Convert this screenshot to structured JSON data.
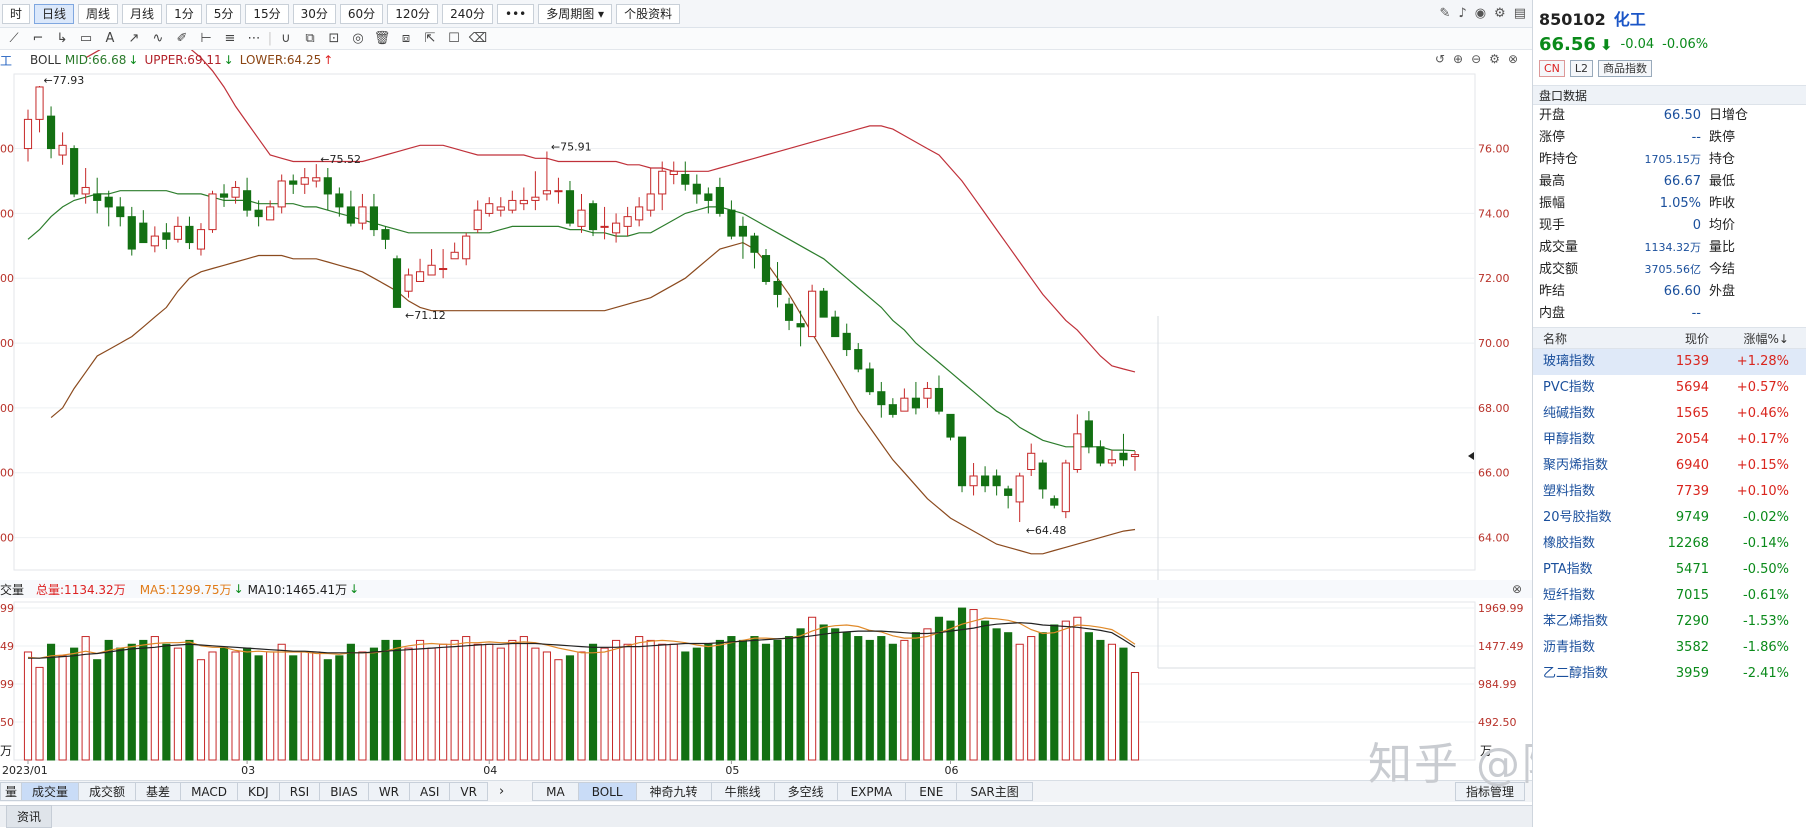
{
  "topbar": {
    "periods": [
      {
        "label": "时",
        "active": false
      },
      {
        "label": "日线",
        "active": true
      },
      {
        "label": "周线",
        "active": false
      },
      {
        "label": "月线",
        "active": false
      },
      {
        "label": "1分",
        "active": false
      },
      {
        "label": "5分",
        "active": false
      },
      {
        "label": "15分",
        "active": false
      },
      {
        "label": "30分",
        "active": false
      },
      {
        "label": "60分",
        "active": false
      },
      {
        "label": "120分",
        "active": false
      },
      {
        "label": "240分",
        "active": false
      },
      {
        "label": "•••",
        "active": false
      },
      {
        "label": "多周期图 ▾",
        "active": false
      },
      {
        "label": "个股资料",
        "active": false
      }
    ]
  },
  "indicator": {
    "name": "BOLL",
    "mid": "MID:66.68",
    "upper": "UPPER:69.11",
    "lower": "LOWER:64.25",
    "left_cut": "工"
  },
  "volume_legend": {
    "left_cut": "交量",
    "total": "总量:1134.32万",
    "ma5": "MA5:1299.75万",
    "ma10": "MA10:1465.41万"
  },
  "annotations": {
    "hi1": "←77.93",
    "hi2": "←75.52",
    "hi3": "←75.91",
    "lo1": "←71.12",
    "lo2": "←64.48"
  },
  "price_axis_right": [
    "76.00",
    "74.00",
    "72.00",
    "70.00",
    "68.00",
    "66.00",
    "64.00"
  ],
  "price_axis_left": [
    "00",
    "00",
    "00",
    "00",
    "00",
    "00",
    "00"
  ],
  "volume_axis_right": [
    "1969.99",
    "1477.49",
    "984.99",
    "492.50"
  ],
  "volume_axis_left": [
    "99",
    "49",
    "99",
    "50"
  ],
  "vol_unit_right": "万",
  "vol_unit_left": "万",
  "date_labels": [
    "2023/01",
    "03",
    "04",
    "05",
    "06"
  ],
  "bottom_tabs_left": [
    "量",
    "成交量",
    "成交额",
    "基差",
    "MACD",
    "KDJ",
    "RSI",
    "BIAS",
    "WR",
    "ASI",
    "VR"
  ],
  "bottom_tabs_right": [
    "MA",
    "BOLL",
    "神奇九转",
    "牛熊线",
    "多空线",
    "EXPMA",
    "ENE",
    "SAR主图"
  ],
  "indicator_manage": "指标管理",
  "status_tab": "资讯",
  "watermark": "知乎 @随波而动",
  "quote": {
    "code": "850102",
    "name": "化工",
    "price": "66.56",
    "change": "-0.04",
    "change_pct": "-0.06%",
    "tags": [
      "CN",
      "L2",
      "商品指数"
    ],
    "section_title": "盘口数据",
    "rows": [
      {
        "l": "开盘",
        "v": "66.50",
        "r": "日增仓",
        "small": false
      },
      {
        "l": "涨停",
        "v": "--",
        "r": "跌停",
        "small": false
      },
      {
        "l": "昨持仓",
        "v": "1705.15万",
        "r": "持仓",
        "small": true
      },
      {
        "l": "最高",
        "v": "66.67",
        "r": "最低",
        "small": false
      },
      {
        "l": "振幅",
        "v": "1.05%",
        "r": "昨收",
        "small": false
      },
      {
        "l": "现手",
        "v": "0",
        "r": "均价",
        "small": false
      },
      {
        "l": "成交量",
        "v": "1134.32万",
        "r": "量比",
        "small": true
      },
      {
        "l": "成交额",
        "v": "3705.56亿",
        "r": "今结",
        "small": true
      },
      {
        "l": "昨结",
        "v": "66.60",
        "r": "外盘",
        "small": false
      },
      {
        "l": "内盘",
        "v": "--",
        "r": "",
        "small": false
      }
    ]
  },
  "index_table": {
    "headers": [
      "名称",
      "现价",
      "涨幅%↓"
    ],
    "rows": [
      {
        "name": "玻璃指数",
        "price": "1539",
        "pct": "+1.28%",
        "up": true
      },
      {
        "name": "PVC指数",
        "price": "5694",
        "pct": "+0.57%",
        "up": true
      },
      {
        "name": "纯碱指数",
        "price": "1565",
        "pct": "+0.46%",
        "up": true
      },
      {
        "name": "甲醇指数",
        "price": "2054",
        "pct": "+0.17%",
        "up": true
      },
      {
        "name": "聚丙烯指数",
        "price": "6940",
        "pct": "+0.15%",
        "up": true
      },
      {
        "name": "塑料指数",
        "price": "7739",
        "pct": "+0.10%",
        "up": true
      },
      {
        "name": "20号胶指数",
        "price": "9749",
        "pct": "-0.02%",
        "up": false
      },
      {
        "name": "橡胶指数",
        "price": "12268",
        "pct": "-0.14%",
        "up": false
      },
      {
        "name": "PTA指数",
        "price": "5471",
        "pct": "-0.50%",
        "up": false
      },
      {
        "name": "短纤指数",
        "price": "7015",
        "pct": "-0.61%",
        "up": false
      },
      {
        "name": "苯乙烯指数",
        "price": "7290",
        "pct": "-1.53%",
        "up": false
      },
      {
        "name": "沥青指数",
        "price": "3582",
        "pct": "-1.86%",
        "up": false
      },
      {
        "name": "乙二醇指数",
        "price": "3959",
        "pct": "-2.41%",
        "up": false
      }
    ]
  },
  "chart_data": {
    "type": "candlestick",
    "y_range": [
      63,
      78.3
    ],
    "volume_range": [
      0,
      1969.99
    ],
    "candles": [
      [
        76.0,
        76.9,
        77.2,
        75.6
      ],
      [
        76.9,
        77.9,
        77.93,
        76.5
      ],
      [
        77.0,
        76.0,
        77.3,
        75.7
      ],
      [
        75.8,
        76.1,
        76.5,
        75.5
      ],
      [
        76.0,
        74.6,
        76.1,
        74.5
      ],
      [
        74.6,
        74.8,
        75.4,
        74.3
      ],
      [
        74.6,
        74.4,
        75.1,
        74.0
      ],
      [
        74.5,
        74.2,
        74.7,
        73.6
      ],
      [
        74.2,
        73.9,
        74.5,
        73.6
      ],
      [
        73.9,
        72.9,
        74.2,
        72.7
      ],
      [
        73.7,
        73.1,
        74.1,
        73.1
      ],
      [
        73.0,
        73.3,
        73.6,
        72.8
      ],
      [
        73.4,
        73.2,
        73.7,
        72.9
      ],
      [
        73.2,
        73.6,
        73.9,
        73.1
      ],
      [
        73.6,
        73.1,
        73.9,
        72.9
      ],
      [
        72.9,
        73.5,
        73.7,
        72.7
      ],
      [
        73.5,
        74.6,
        74.7,
        73.4
      ],
      [
        74.6,
        74.5,
        74.9,
        74.2
      ],
      [
        74.5,
        74.8,
        75.0,
        74.3
      ],
      [
        74.7,
        74.1,
        75.1,
        73.9
      ],
      [
        74.1,
        73.9,
        74.4,
        73.6
      ],
      [
        73.8,
        74.2,
        74.4,
        73.8
      ],
      [
        74.2,
        75.0,
        75.2,
        74.0
      ],
      [
        75.0,
        74.9,
        75.2,
        74.6
      ],
      [
        74.9,
        75.1,
        75.4,
        74.6
      ],
      [
        75.0,
        75.1,
        75.52,
        74.8
      ],
      [
        75.1,
        74.6,
        75.4,
        74.1
      ],
      [
        74.6,
        74.2,
        74.8,
        73.9
      ],
      [
        74.2,
        73.7,
        74.7,
        73.6
      ],
      [
        73.7,
        74.2,
        74.6,
        73.5
      ],
      [
        74.2,
        73.5,
        74.6,
        73.3
      ],
      [
        73.5,
        73.2,
        73.6,
        72.9
      ],
      [
        72.6,
        71.1,
        72.7,
        71.12
      ],
      [
        71.6,
        72.1,
        72.3,
        71.4
      ],
      [
        71.9,
        72.2,
        72.6,
        71.9
      ],
      [
        72.1,
        72.4,
        72.9,
        72.1
      ],
      [
        72.3,
        72.3,
        72.9,
        72.0
      ],
      [
        72.6,
        72.8,
        73.1,
        72.6
      ],
      [
        72.6,
        73.3,
        73.4,
        72.4
      ],
      [
        73.5,
        74.1,
        74.4,
        73.4
      ],
      [
        74.0,
        74.3,
        74.5,
        73.9
      ],
      [
        74.1,
        74.2,
        74.5,
        73.9
      ],
      [
        74.1,
        74.4,
        74.7,
        74.0
      ],
      [
        74.3,
        74.4,
        74.8,
        74.1
      ],
      [
        74.4,
        74.5,
        75.3,
        74.1
      ],
      [
        74.6,
        74.7,
        75.91,
        74.4
      ],
      [
        74.7,
        74.7,
        75.1,
        74.3
      ],
      [
        74.7,
        73.7,
        75.0,
        73.6
      ],
      [
        73.6,
        74.1,
        74.6,
        73.4
      ],
      [
        74.3,
        73.5,
        74.4,
        73.3
      ],
      [
        73.6,
        73.6,
        74.2,
        73.2
      ],
      [
        73.4,
        73.7,
        74.0,
        73.1
      ],
      [
        73.6,
        73.9,
        74.2,
        73.3
      ],
      [
        73.8,
        74.2,
        74.5,
        73.6
      ],
      [
        74.1,
        74.6,
        75.4,
        73.9
      ],
      [
        74.6,
        75.3,
        75.6,
        74.1
      ],
      [
        75.2,
        75.3,
        75.6,
        74.9
      ],
      [
        75.2,
        74.9,
        75.6,
        74.7
      ],
      [
        74.9,
        74.6,
        75.2,
        74.3
      ],
      [
        74.6,
        74.4,
        74.8,
        74.0
      ],
      [
        74.8,
        74.0,
        75.1,
        73.9
      ],
      [
        74.1,
        73.3,
        74.4,
        73.2
      ],
      [
        73.6,
        73.3,
        73.9,
        72.6
      ],
      [
        73.3,
        72.8,
        73.4,
        72.3
      ],
      [
        72.7,
        71.9,
        72.9,
        71.8
      ],
      [
        71.9,
        71.5,
        72.5,
        71.1
      ],
      [
        71.2,
        70.7,
        71.4,
        70.4
      ],
      [
        70.6,
        70.5,
        71.0,
        69.9
      ],
      [
        70.2,
        71.6,
        71.8,
        70.2
      ],
      [
        71.6,
        70.8,
        71.7,
        70.8
      ],
      [
        70.8,
        70.2,
        71.0,
        70.2
      ],
      [
        70.3,
        69.8,
        70.6,
        69.6
      ],
      [
        69.8,
        69.2,
        70.0,
        69.1
      ],
      [
        69.2,
        68.5,
        69.4,
        68.4
      ],
      [
        68.5,
        68.1,
        68.8,
        67.7
      ],
      [
        68.1,
        67.8,
        68.3,
        67.7
      ],
      [
        67.9,
        68.3,
        68.6,
        67.9
      ],
      [
        68.3,
        68.0,
        68.8,
        67.8
      ],
      [
        68.3,
        68.6,
        68.8,
        68.0
      ],
      [
        68.6,
        67.9,
        69.0,
        67.8
      ],
      [
        67.8,
        67.1,
        67.8,
        67.0
      ],
      [
        67.1,
        65.6,
        67.1,
        65.4
      ],
      [
        65.6,
        65.9,
        66.3,
        65.3
      ],
      [
        65.9,
        65.6,
        66.2,
        65.4
      ],
      [
        65.9,
        65.6,
        66.1,
        65.3
      ],
      [
        65.5,
        65.3,
        65.6,
        64.9
      ],
      [
        65.1,
        65.9,
        66.0,
        64.48
      ],
      [
        66.1,
        66.6,
        66.9,
        65.9
      ],
      [
        66.3,
        65.5,
        66.4,
        65.2
      ],
      [
        65.2,
        65.0,
        65.3,
        64.9
      ],
      [
        64.8,
        66.3,
        66.4,
        64.6
      ],
      [
        66.1,
        67.2,
        67.8,
        66.0
      ],
      [
        67.6,
        66.8,
        67.9,
        66.6
      ],
      [
        66.8,
        66.3,
        67.0,
        66.2
      ],
      [
        66.3,
        66.4,
        66.7,
        66.2
      ],
      [
        66.6,
        66.4,
        67.2,
        66.2
      ],
      [
        66.5,
        66.56,
        66.67,
        66.06
      ]
    ],
    "boll_mid": [
      73.2,
      73.5,
      73.9,
      74.2,
      74.4,
      74.5,
      74.6,
      74.6,
      74.7,
      74.7,
      74.7,
      74.7,
      74.7,
      74.6,
      74.6,
      74.6,
      74.5,
      74.4,
      74.4,
      74.4,
      74.3,
      74.3,
      74.3,
      74.3,
      74.2,
      74.2,
      74.1,
      74.0,
      73.9,
      73.8,
      73.7,
      73.6,
      73.5,
      73.4,
      73.4,
      73.4,
      73.4,
      73.4,
      73.4,
      73.4,
      73.4,
      73.5,
      73.6,
      73.6,
      73.6,
      73.6,
      73.6,
      73.5,
      73.5,
      73.4,
      73.4,
      73.3,
      73.3,
      73.4,
      73.4,
      73.6,
      73.8,
      74.0,
      74.1,
      74.2,
      74.2,
      74.1,
      74.0,
      73.8,
      73.6,
      73.4,
      73.2,
      73.0,
      72.8,
      72.6,
      72.3,
      72.0,
      71.7,
      71.4,
      71.1,
      70.7,
      70.4,
      70.0,
      69.7,
      69.4,
      69.1,
      68.8,
      68.5,
      68.2,
      67.9,
      67.7,
      67.4,
      67.2,
      67.0,
      66.9,
      66.8,
      66.8,
      66.8,
      66.8,
      66.7,
      66.7,
      66.68
    ],
    "boll_upper": [
      78.8,
      79.0,
      79.2,
      79.3,
      79.4,
      79.4,
      79.4,
      79.3,
      79.2,
      79.1,
      78.8,
      78.4,
      77.9,
      77.3,
      76.8,
      76.3,
      75.8,
      75.7,
      75.6,
      75.6,
      75.6,
      75.6,
      75.6,
      75.6,
      75.6,
      75.7,
      75.8,
      75.9,
      76.0,
      76.1,
      76.1,
      76.1,
      76.0,
      75.9,
      75.8,
      75.8,
      75.8,
      75.8,
      75.8,
      75.7,
      75.7,
      75.6,
      75.6,
      75.6,
      75.6,
      75.6,
      75.6,
      75.5,
      75.5,
      75.4,
      75.4,
      75.3,
      75.3,
      75.3,
      75.3,
      75.4,
      75.5,
      75.6,
      75.7,
      75.8,
      75.9,
      76.0,
      76.1,
      76.2,
      76.3,
      76.4,
      76.5,
      76.6,
      76.7,
      76.7,
      76.6,
      76.4,
      76.2,
      76.0,
      75.8,
      75.4,
      75.0,
      74.5,
      74.0,
      73.5,
      73.0,
      72.5,
      72.0,
      71.5,
      71.1,
      70.7,
      70.4,
      70.0,
      69.6,
      69.3,
      69.2,
      69.11
    ],
    "boll_lower": [
      67.7,
      68.0,
      68.6,
      69.1,
      69.6,
      69.8,
      70.0,
      70.2,
      70.5,
      70.8,
      71.1,
      71.6,
      72.0,
      72.2,
      72.3,
      72.4,
      72.5,
      72.6,
      72.7,
      72.7,
      72.7,
      72.6,
      72.6,
      72.6,
      72.5,
      72.4,
      72.3,
      72.2,
      72.0,
      71.8,
      71.6,
      71.3,
      71.1,
      71.0,
      71.0,
      71.0,
      71.0,
      71.0,
      71.0,
      71.0,
      71.0,
      71.0,
      71.0,
      71.0,
      71.0,
      71.0,
      71.0,
      71.0,
      71.0,
      71.1,
      71.2,
      71.3,
      71.4,
      71.6,
      71.8,
      72.0,
      72.3,
      72.6,
      72.9,
      73.0,
      73.1,
      72.9,
      72.5,
      72.0,
      71.5,
      70.9,
      70.3,
      69.7,
      69.1,
      68.5,
      67.9,
      67.4,
      66.9,
      66.4,
      66.0,
      65.6,
      65.2,
      64.9,
      64.6,
      64.4,
      64.2,
      64.0,
      63.8,
      63.7,
      63.6,
      63.5,
      63.5,
      63.6,
      63.7,
      63.8,
      63.9,
      64.0,
      64.1,
      64.2,
      64.25
    ],
    "volumes": [
      1400,
      1200,
      1500,
      1350,
      1450,
      1600,
      1300,
      1550,
      1450,
      1500,
      1550,
      1600,
      1500,
      1450,
      1550,
      1300,
      1400,
      1450,
      1400,
      1450,
      1350,
      1400,
      1500,
      1350,
      1400,
      1400,
      1300,
      1350,
      1500,
      1400,
      1450,
      1550,
      1550,
      1450,
      1550,
      1450,
      1500,
      1550,
      1600,
      1500,
      1500,
      1450,
      1550,
      1600,
      1450,
      1400,
      1300,
      1350,
      1400,
      1500,
      1450,
      1550,
      1500,
      1600,
      1550,
      1500,
      1500,
      1400,
      1450,
      1500,
      1550,
      1600,
      1550,
      1600,
      1500,
      1550,
      1600,
      1700,
      1850,
      1750,
      1700,
      1650,
      1600,
      1550,
      1600,
      1500,
      1550,
      1650,
      1700,
      1850,
      1800,
      1969,
      1950,
      1800,
      1700,
      1650,
      1500,
      1600,
      1650,
      1750,
      1800,
      1850,
      1650,
      1550,
      1500,
      1450,
      1134
    ],
    "ma5": [
      1330,
      1320,
      1350,
      1360,
      1380,
      1410,
      1380,
      1420,
      1450,
      1470,
      1490,
      1510,
      1520,
      1520,
      1530,
      1480,
      1460,
      1460,
      1420,
      1400,
      1410,
      1400,
      1400,
      1400,
      1400,
      1380,
      1380,
      1370,
      1390,
      1390,
      1390,
      1410,
      1450,
      1480,
      1500,
      1510,
      1500,
      1500,
      1520,
      1520,
      1530,
      1520,
      1520,
      1530,
      1520,
      1490,
      1450,
      1420,
      1390,
      1390,
      1400,
      1440,
      1480,
      1520,
      1540,
      1550,
      1540,
      1520,
      1490,
      1470,
      1490,
      1520,
      1550,
      1580,
      1580,
      1570,
      1580,
      1610,
      1670,
      1720,
      1740,
      1750,
      1730,
      1680,
      1660,
      1610,
      1580,
      1580,
      1600,
      1650,
      1700,
      1760,
      1800,
      1840,
      1830,
      1810,
      1770,
      1690,
      1640,
      1650,
      1700,
      1750,
      1740,
      1720,
      1690,
      1600,
      1499
    ],
    "ma10": [
      1320,
      1320,
      1330,
      1340,
      1350,
      1370,
      1380,
      1400,
      1420,
      1440,
      1450,
      1460,
      1480,
      1490,
      1500,
      1490,
      1480,
      1470,
      1460,
      1450,
      1440,
      1430,
      1420,
      1410,
      1410,
      1400,
      1390,
      1390,
      1390,
      1390,
      1400,
      1410,
      1420,
      1430,
      1440,
      1450,
      1460,
      1470,
      1480,
      1490,
      1500,
      1500,
      1510,
      1510,
      1510,
      1500,
      1490,
      1480,
      1470,
      1460,
      1460,
      1460,
      1470,
      1470,
      1480,
      1490,
      1500,
      1510,
      1510,
      1510,
      1520,
      1530,
      1540,
      1550,
      1560,
      1570,
      1580,
      1590,
      1610,
      1630,
      1650,
      1660,
      1670,
      1670,
      1670,
      1660,
      1650,
      1640,
      1640,
      1650,
      1670,
      1690,
      1710,
      1740,
      1760,
      1770,
      1780,
      1770,
      1750,
      1740,
      1730,
      1720,
      1700,
      1680,
      1650,
      1560,
      1465
    ]
  }
}
